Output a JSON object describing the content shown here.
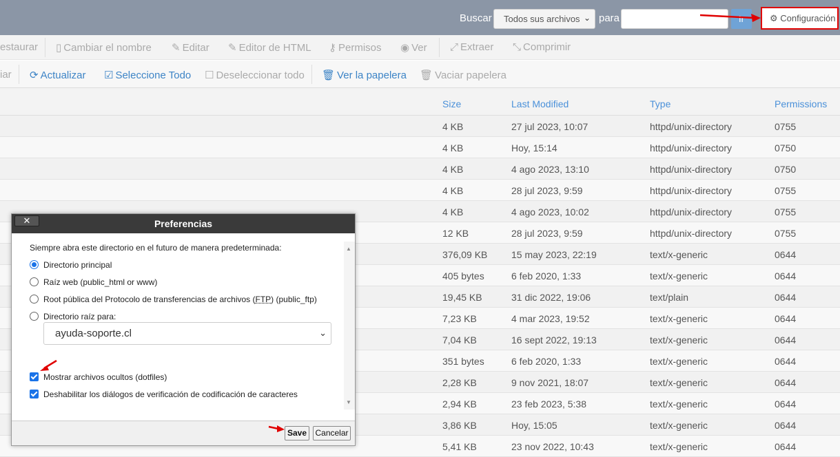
{
  "topbar": {
    "search_label": "Buscar",
    "search_scope": "Todos sus archivos",
    "for_label": "para",
    "search_value": "",
    "go_label": "Ir",
    "settings_label": "Configuración"
  },
  "toolbar1": {
    "restore": "estaurar",
    "rename": "Cambiar el nombre",
    "edit": "Editar",
    "html_editor": "Editor de HTML",
    "permissions": "Permisos",
    "view": "Ver",
    "extract": "Extraer",
    "compress": "Comprimir"
  },
  "toolbar2": {
    "partial": "iar",
    "reload": "Actualizar",
    "select_all": "Seleccione Todo",
    "deselect_all": "Deseleccionar todo",
    "view_trash": "Ver la papelera",
    "empty_trash": "Vaciar papelera"
  },
  "table": {
    "headers": {
      "size": "Size",
      "modified": "Last Modified",
      "type": "Type",
      "perms": "Permissions"
    },
    "rows": [
      {
        "size": "4 KB",
        "modified": "27 jul 2023, 10:07",
        "type": "httpd/unix-directory",
        "perms": "0755"
      },
      {
        "size": "4 KB",
        "modified": "Hoy, 15:14",
        "type": "httpd/unix-directory",
        "perms": "0750"
      },
      {
        "size": "4 KB",
        "modified": "4 ago 2023, 13:10",
        "type": "httpd/unix-directory",
        "perms": "0750"
      },
      {
        "size": "4 KB",
        "modified": "28 jul 2023, 9:59",
        "type": "httpd/unix-directory",
        "perms": "0755"
      },
      {
        "size": "4 KB",
        "modified": "4 ago 2023, 10:02",
        "type": "httpd/unix-directory",
        "perms": "0755"
      },
      {
        "size": "12 KB",
        "modified": "28 jul 2023, 9:59",
        "type": "httpd/unix-directory",
        "perms": "0755"
      },
      {
        "size": "376,09 KB",
        "modified": "15 may 2023, 22:19",
        "type": "text/x-generic",
        "perms": "0644"
      },
      {
        "size": "405 bytes",
        "modified": "6 feb 2020, 1:33",
        "type": "text/x-generic",
        "perms": "0644"
      },
      {
        "size": "19,45 KB",
        "modified": "31 dic 2022, 19:06",
        "type": "text/plain",
        "perms": "0644"
      },
      {
        "size": "7,23 KB",
        "modified": "4 mar 2023, 19:52",
        "type": "text/x-generic",
        "perms": "0644"
      },
      {
        "size": "7,04 KB",
        "modified": "16 sept 2022, 19:13",
        "type": "text/x-generic",
        "perms": "0644"
      },
      {
        "size": "351 bytes",
        "modified": "6 feb 2020, 1:33",
        "type": "text/x-generic",
        "perms": "0644"
      },
      {
        "size": "2,28 KB",
        "modified": "9 nov 2021, 18:07",
        "type": "text/x-generic",
        "perms": "0644"
      },
      {
        "size": "2,94 KB",
        "modified": "23 feb 2023, 5:38",
        "type": "text/x-generic",
        "perms": "0644"
      },
      {
        "size": "3,86 KB",
        "modified": "Hoy, 15:05",
        "type": "text/x-generic",
        "perms": "0644"
      },
      {
        "size": "5,41 KB",
        "modified": "23 nov 2022, 10:43",
        "type": "text/x-generic",
        "perms": "0644"
      }
    ]
  },
  "dialog": {
    "title": "Preferencias",
    "close_label": "✕",
    "prompt": "Siempre abra este directorio en el futuro de manera predeterminada:",
    "options": {
      "home": "Directorio principal",
      "web_root": "Raíz web (public_html or www)",
      "ftp_root_pre": "Root pública del Protocolo de transferencias de archivos (",
      "ftp_abbr": "FTP",
      "ftp_root_post": ") (public_ftp)",
      "docroot": "Directorio raíz para:"
    },
    "selected_option": "home",
    "domain": "ayuda-soporte.cl",
    "show_hidden": "Mostrar archivos ocultos (dotfiles)",
    "show_hidden_checked": true,
    "disable_encoding": "Deshabilitar los diálogos de verificación de codificación de caracteres",
    "disable_encoding_checked": true,
    "save_label": "Save",
    "cancel_label": "Cancelar"
  },
  "colors": {
    "annotation": "#e00000",
    "link": "#4a90d9",
    "accent": "#1a73e8",
    "topbar": "#8b96a6"
  }
}
